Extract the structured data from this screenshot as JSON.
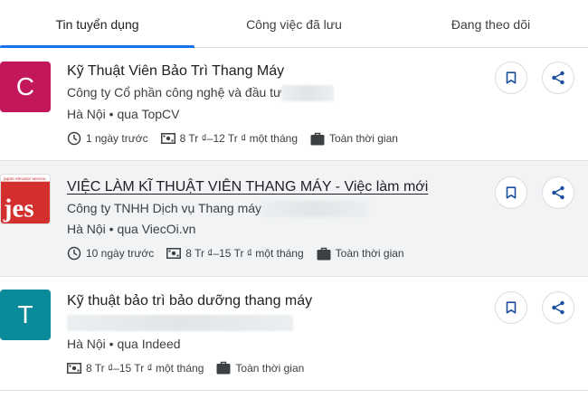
{
  "tabs": [
    {
      "label": "Tin tuyển dụng",
      "active": true
    },
    {
      "label": "Công việc đã lưu",
      "active": false
    },
    {
      "label": "Đang theo dõi",
      "active": false
    }
  ],
  "colors": {
    "accent": "#1a73e8",
    "logo_c": "#c2185b",
    "logo_t": "#0b8a99",
    "jes_red": "#d32f2f"
  },
  "jobs": [
    {
      "logo_letter": "C",
      "title": "Kỹ Thuật Viên Bảo Trì Thang Máy",
      "company": "Công ty Cổ phần công nghệ và đầu tư",
      "location": "Hà Nội • qua TopCV",
      "posted": "1 ngày trước",
      "salary": "8 Tr ₫–12 Tr ₫ một tháng",
      "type": "Toàn thời gian"
    },
    {
      "logo_letter": "jes",
      "title": "VIỆC LÀM KĨ THUẬT VIÊN THANG MÁY - Việc làm mới",
      "company": "Công ty TNHH Dịch vụ Thang máy",
      "location": "Hà Nội • qua ViecOi.vn",
      "posted": "10 ngày trước",
      "salary": "8 Tr ₫–15 Tr ₫ một tháng",
      "type": "Toàn thời gian"
    },
    {
      "logo_letter": "T",
      "title": "Kỹ thuật bảo trì bảo dưỡng thang máy",
      "company": "",
      "location": "Hà Nội • qua Indeed",
      "posted": "",
      "salary": "8 Tr ₫–15 Tr ₫ một tháng",
      "type": "Toàn thời gian"
    }
  ]
}
